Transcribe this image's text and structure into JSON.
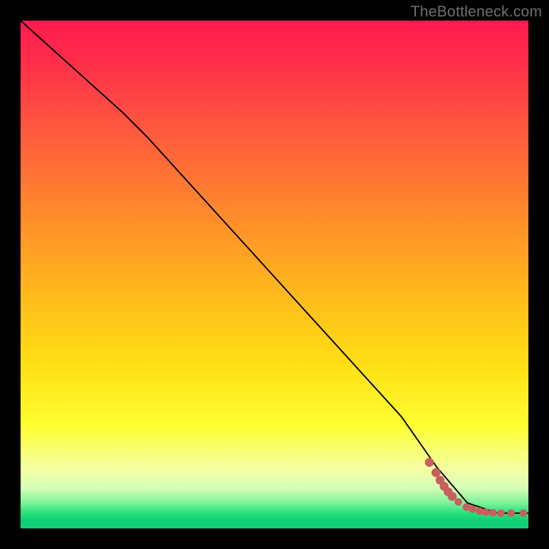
{
  "attribution": "TheBottleneck.com",
  "colors": {
    "dot": "#c85f5d",
    "curve": "#000000",
    "frame": "#000000"
  },
  "chart_data": {
    "type": "line",
    "title": "",
    "xlabel": "",
    "ylabel": "",
    "xlim": [
      0,
      100
    ],
    "ylim": [
      0,
      100
    ],
    "grid": false,
    "legend": false,
    "note": "Axes unlabeled in source; x/y are normalized 0–100. Curve is a bottleneck-style decreasing line with a knee near x≈25 and flattening near y≈3 for x≳82. Dots mark sampled points along the low flat region.",
    "series": [
      {
        "name": "curve",
        "kind": "line",
        "x": [
          0,
          10,
          20,
          25,
          35,
          45,
          55,
          65,
          75,
          82,
          88,
          94,
          100
        ],
        "y": [
          100,
          91,
          82,
          77,
          66,
          55,
          44,
          33,
          22,
          12,
          5,
          3,
          3
        ]
      },
      {
        "name": "dots",
        "kind": "scatter",
        "x": [
          80.5,
          81.8,
          82.6,
          83.4,
          84.2,
          85.0,
          86.2,
          87.8,
          89.0,
          90.4,
          91.6,
          93.0,
          94.6,
          96.6,
          99.0
        ],
        "y": [
          13.0,
          11.0,
          9.5,
          8.3,
          7.2,
          6.3,
          5.2,
          4.2,
          3.8,
          3.4,
          3.2,
          3.1,
          3.0,
          3.0,
          3.0
        ]
      }
    ],
    "background_gradient_stops": [
      {
        "pos": 0.0,
        "color": "#ff1a4f"
      },
      {
        "pos": 0.22,
        "color": "#ff5a3e"
      },
      {
        "pos": 0.52,
        "color": "#ffb41e"
      },
      {
        "pos": 0.8,
        "color": "#feff33"
      },
      {
        "pos": 0.92,
        "color": "#d7ffb6"
      },
      {
        "pos": 0.97,
        "color": "#27e07e"
      },
      {
        "pos": 1.0,
        "color": "#15cf79"
      }
    ]
  }
}
